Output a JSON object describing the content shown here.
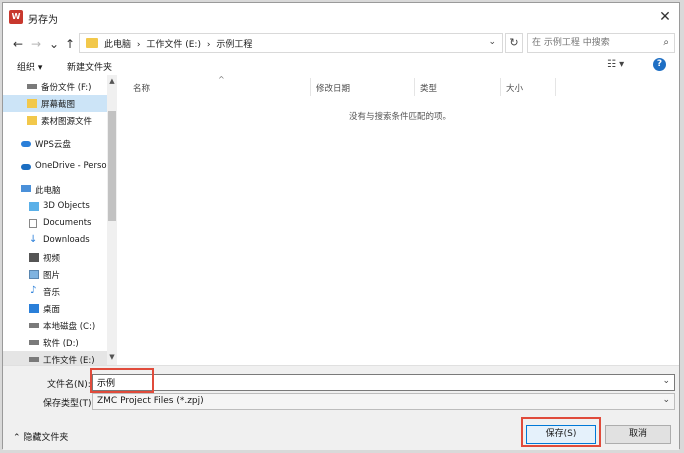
{
  "window": {
    "title": "另存为",
    "app_icon_text": "W"
  },
  "nav_buttons": {
    "back": "←",
    "forward": "→",
    "recent": "⌄",
    "up": "↑"
  },
  "address": {
    "crumbs": [
      "此电脑",
      "›",
      "工作文件 (E:)",
      "›",
      "示例工程"
    ],
    "dropdown": "⌄",
    "refresh": "↻"
  },
  "search": {
    "placeholder": "在 示例工程 中搜索",
    "icon": "⌕"
  },
  "toolbar": {
    "organize": "组织 ▾",
    "new_folder": "新建文件夹",
    "view": "☷ ▾",
    "help": "?"
  },
  "sidebar": {
    "items": [
      {
        "label": "备份文件 (F:)",
        "icon": "drive-icon"
      },
      {
        "label": "屏幕截图",
        "icon": "folder-icon",
        "selected": true
      },
      {
        "label": "素材图源文件",
        "icon": "folder-icon"
      },
      {
        "label": "WPS云盘",
        "icon": "cloud-icon"
      },
      {
        "label": "OneDrive - Perso",
        "icon": "onedrive-icon"
      },
      {
        "label": "此电脑",
        "icon": "pc-icon"
      },
      {
        "label": "3D Objects",
        "icon": "cube-icon"
      },
      {
        "label": "Documents",
        "icon": "document-icon"
      },
      {
        "label": "Downloads",
        "icon": "download-icon"
      },
      {
        "label": "视频",
        "icon": "video-icon"
      },
      {
        "label": "图片",
        "icon": "picture-icon"
      },
      {
        "label": "音乐",
        "icon": "music-icon"
      },
      {
        "label": "桌面",
        "icon": "desktop-icon"
      },
      {
        "label": "本地磁盘 (C:)",
        "icon": "drive-icon"
      },
      {
        "label": "软件 (D:)",
        "icon": "drive-icon"
      },
      {
        "label": "工作文件 (E:)",
        "icon": "drive-icon",
        "selected": true
      }
    ]
  },
  "columns": {
    "name": "名称",
    "modified": "修改日期",
    "type": "类型",
    "size": "大小",
    "sort_indicator": "^"
  },
  "empty_message": "没有与搜索条件匹配的项。",
  "form": {
    "filename_label": "文件名(N):",
    "filename_value": "示例",
    "filetype_label": "保存类型(T):",
    "filetype_value": "ZMC Project Files (*.zpj)",
    "hide_folders": "⌃  隐藏文件夹",
    "save": "保存(S)",
    "cancel": "取消"
  },
  "colors": {
    "highlight": "#e04b3b",
    "selection": "#cce4f7",
    "accent": "#0078d7"
  }
}
